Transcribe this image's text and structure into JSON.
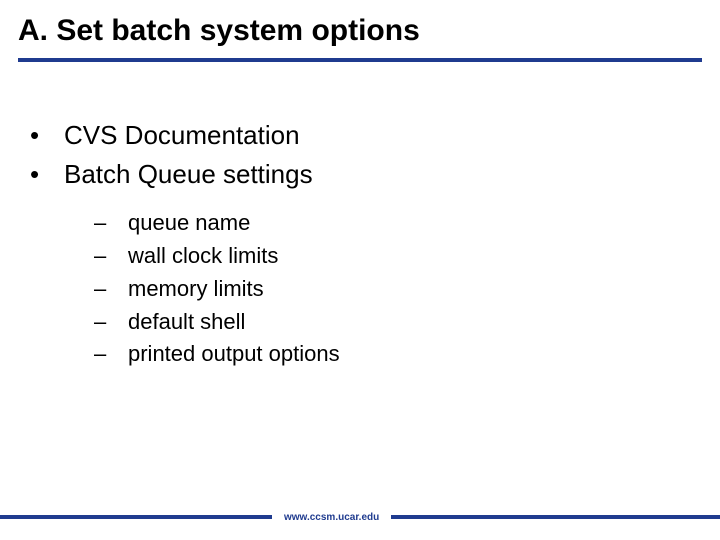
{
  "title": "A. Set batch system options",
  "bullets": [
    {
      "text": "CVS Documentation"
    },
    {
      "text": "Batch Queue settings"
    }
  ],
  "subbullets": [
    {
      "text": "queue name"
    },
    {
      "text": "wall clock limits"
    },
    {
      "text": "memory limits"
    },
    {
      "text": "default shell"
    },
    {
      "text": "printed output options"
    }
  ],
  "footer_url": "www.ccsm.ucar.edu",
  "colors": {
    "accent": "#1f3b8f"
  }
}
